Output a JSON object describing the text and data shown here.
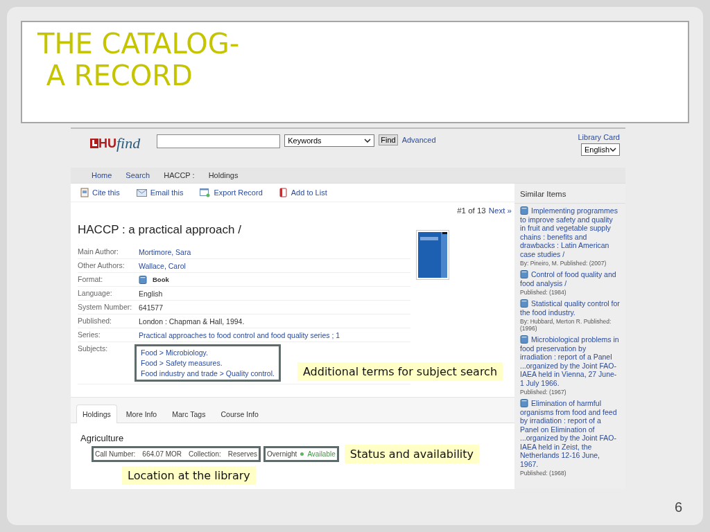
{
  "slide": {
    "title_lines": [
      "THE CATALOG-",
      "A RECORD"
    ],
    "page_number": "6"
  },
  "header": {
    "logo": {
      "brand": "HU",
      "script": "find"
    },
    "search_type": "Keywords",
    "find_button": "Find",
    "advanced_link": "Advanced",
    "library_card": "Library Card",
    "language": "English"
  },
  "breadcrumbs": [
    {
      "label": "Home",
      "kind": "link"
    },
    {
      "label": "Search",
      "kind": "link"
    },
    {
      "label": "HACCP :",
      "kind": "text"
    },
    {
      "label": "Holdings",
      "kind": "text"
    }
  ],
  "toolbar": [
    {
      "label": "Cite this",
      "kind": "cite"
    },
    {
      "label": "Email this",
      "kind": "email"
    },
    {
      "label": "Export Record",
      "kind": "export"
    },
    {
      "label": "Add to List",
      "kind": "list"
    }
  ],
  "record": {
    "title": "HACCP : a practical approach /",
    "position": "#1 of 13",
    "next": "Next »",
    "fields": [
      {
        "label": "Main Author:",
        "kind": "link",
        "values": [
          "Mortimore, Sara"
        ]
      },
      {
        "label": "Other Authors:",
        "kind": "link",
        "values": [
          "Wallace, Carol"
        ]
      },
      {
        "label": "Format:",
        "kind": "format",
        "values": [
          "Book"
        ]
      },
      {
        "label": "Language:",
        "kind": "text",
        "values": [
          "English"
        ]
      },
      {
        "label": "System Number:",
        "kind": "text",
        "values": [
          "641577"
        ]
      },
      {
        "label": "Published:",
        "kind": "text",
        "values": [
          "London : Chapman & Hall, 1994."
        ]
      },
      {
        "label": "Series:",
        "kind": "link",
        "values": [
          "Practical approaches to food control and food quality series ; 1"
        ]
      },
      {
        "label": "Subjects:",
        "kind": "subjects",
        "highlighted": true,
        "values": [
          "Food > Microbiology.",
          "Food > Safety measures.",
          "Food industry and trade > Quality control."
        ]
      }
    ]
  },
  "tabs": [
    {
      "label": "Holdings",
      "selected": true
    },
    {
      "label": "More Info",
      "selected": false
    },
    {
      "label": "Marc Tags",
      "selected": false
    },
    {
      "label": "Course Info",
      "selected": false
    }
  ],
  "holdings": {
    "location": "Agriculture",
    "call_number_label": "Call Number:",
    "call_number": "664.07 MOR",
    "collection_label": "Collection:",
    "collection": "Reserves",
    "loan_type": "Overnight",
    "status": "Available",
    "available": true
  },
  "callouts": {
    "subjects": "Additional terms for subject search",
    "status": "Status and availability",
    "location": "Location at the library"
  },
  "similar": {
    "heading": "Similar Items",
    "items": [
      {
        "title": "Implementing programmes to improve safety and quality in fruit and vegetable supply chains : benefits and drawbacks : Latin American case studies /",
        "meta": "By: Pineiro, M. Published: (2007)"
      },
      {
        "title": "Control of food quality and food analysis /",
        "meta": "Published: (1984)"
      },
      {
        "title": "Statistical quality control for the food industry.",
        "meta": "By: Hubbard, Merton R. Published: (1996)"
      },
      {
        "title": "Microbiological problems in food preservation by irradiation : report of a Panel ...organized by the Joint FAO-IAEA held in Vienna, 27 June-1 July 1966.",
        "meta": "Published: (1967)"
      },
      {
        "title": "Elimination of harmful organisms from food and feed by irradiation : report of a Panel on Elimination of ...organized by the Joint FAO-IAEA held in Zeist, the Netherlands 12-16 June, 1967.",
        "meta": "Published: (1968)"
      }
    ]
  }
}
